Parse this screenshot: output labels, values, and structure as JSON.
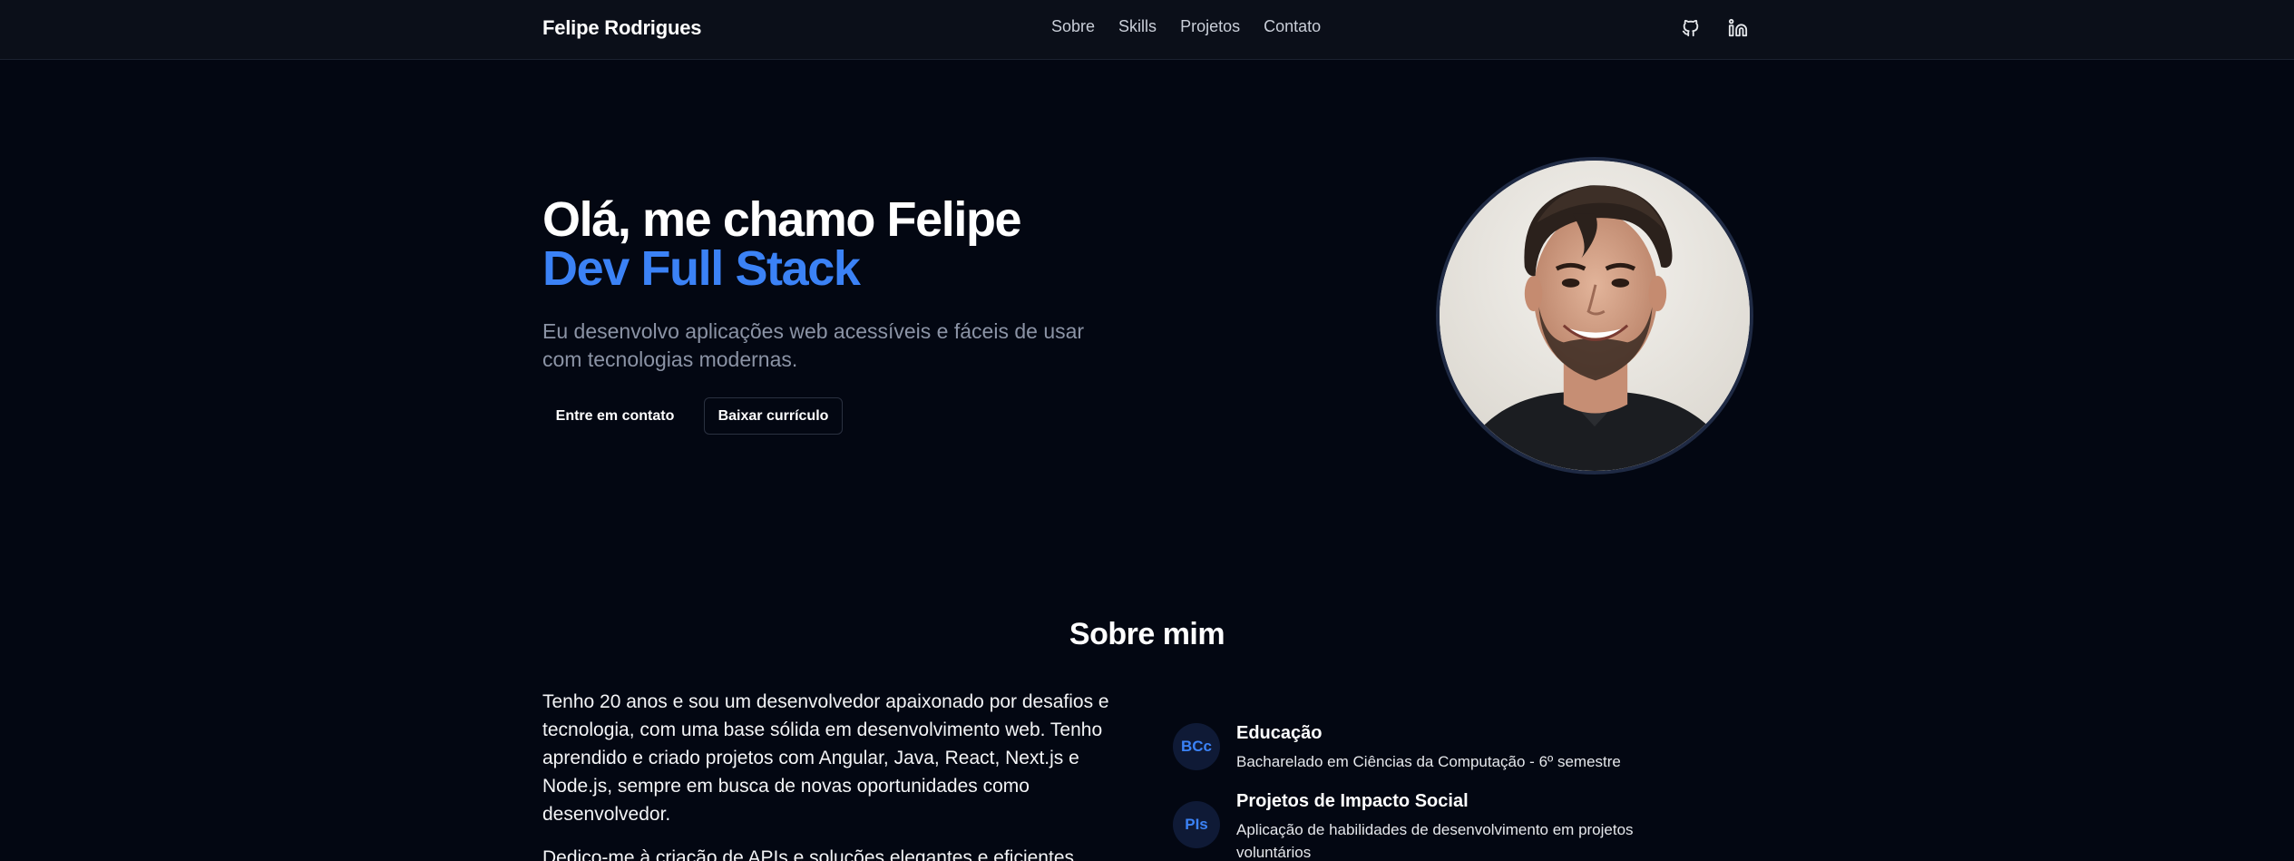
{
  "navbar": {
    "brand": "Felipe Rodrigues",
    "links": [
      "Sobre",
      "Skills",
      "Projetos",
      "Contato"
    ],
    "icons": [
      "github-icon",
      "linkedin-icon"
    ]
  },
  "hero": {
    "title_line1": "Olá, me chamo Felipe",
    "title_line2": "Dev Full Stack",
    "subtitle": "Eu desenvolvo aplicações web acessíveis e fáceis de usar com tecnologias modernas.",
    "button_contact": "Entre em contato",
    "button_cv": "Baixar currículo"
  },
  "about": {
    "title": "Sobre mim",
    "paragraph1": "Tenho 20 anos e sou um desenvolvedor apaixonado por desafios e tecnologia, com uma base sólida em desenvolvimento web. Tenho aprendido e criado projetos com Angular, Java, React, Next.js e Node.js, sempre em busca de novas oportunidades como desenvolvedor.",
    "paragraph2": "Dedico-me à criação de APIs e soluções elegantes e eficientes",
    "items": [
      {
        "badge": "BCc",
        "title": "Educação",
        "description": "Bacharelado em Ciências da Computação - 6º semestre"
      },
      {
        "badge": "PIs",
        "title": "Projetos de Impacto Social",
        "description": "Aplicação de habilidades de desenvolvimento em projetos voluntários"
      }
    ]
  },
  "colors": {
    "background": "#030712",
    "navbar": "#0b0f19",
    "accent": "#3b82f6",
    "muted_text": "#8b93a5"
  }
}
